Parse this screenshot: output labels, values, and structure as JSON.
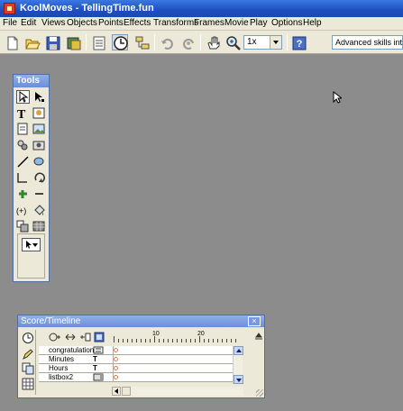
{
  "window": {
    "title": "KoolMoves - TellingTime.fun"
  },
  "menu": [
    "File",
    "Edit",
    "Views",
    "Objects",
    "Points",
    "Effects",
    "Transforms",
    "Frames",
    "Movie",
    "Play",
    "Options",
    "Help"
  ],
  "toolbar": {
    "zoom_value": "1x",
    "mode_text": "Advanced skills interface",
    "icons": [
      "new-icon",
      "open-icon",
      "save-icon",
      "export-icon",
      "properties-icon",
      "clock-icon",
      "hierarchy-icon",
      "undo-icon",
      "redo-icon",
      "hand-icon",
      "zoom-icon",
      "help-icon"
    ]
  },
  "tools_palette": {
    "title": "Tools",
    "tools": [
      "select-arrow-icon",
      "subselect-arrow-icon",
      "text-icon",
      "text-box-icon",
      "frame-icon",
      "picture-icon",
      "eyedropper-icon",
      "camera-icon",
      "line-icon",
      "oval-icon",
      "curve-icon",
      "rotate-icon",
      "add-point-icon",
      "remove-point-icon",
      "flip-icon",
      "bucket-icon",
      "shape-icon",
      "gradient-icon"
    ]
  },
  "timeline": {
    "title": "Score/Timeline",
    "ruler_labels": [
      "10",
      "20"
    ],
    "layers": [
      {
        "name": "congratulation",
        "type_icon": "html-icon"
      },
      {
        "name": "Minutes",
        "type": "T"
      },
      {
        "name": "Hours",
        "type": "T"
      },
      {
        "name": "listbox2",
        "type_icon": "listbox-icon"
      }
    ]
  },
  "colors": {
    "canvas": "#8c8c8c",
    "titlebar": "#1d4fc0",
    "chrome": "#ece9d8"
  }
}
